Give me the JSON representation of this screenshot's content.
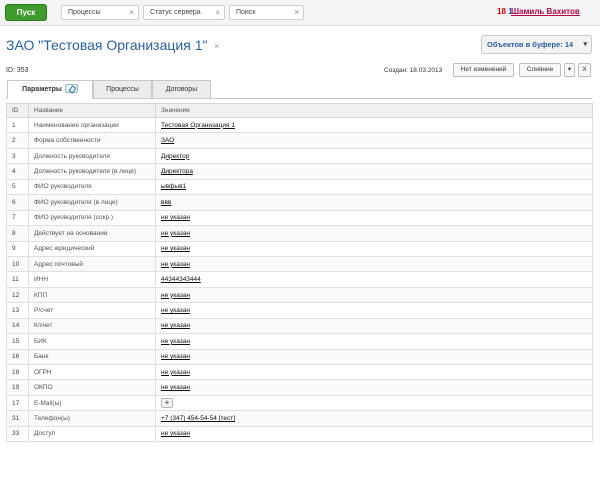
{
  "topbar": {
    "start_label": "Пуск",
    "tabs": [
      {
        "label": "Процессы"
      },
      {
        "label": "Статус сервера"
      },
      {
        "label": "Поиск"
      }
    ],
    "close_glyph": "×",
    "notif_count_red": "18",
    "notif_count_blue": "1",
    "user_name": "Шамиль Вахитов"
  },
  "header": {
    "title": "ЗАО \"Тестовая Организация 1\"",
    "close_glyph": "×",
    "buffer_label": "Объектов в буфере: 14",
    "buffer_caret": "▾"
  },
  "meta": {
    "id_text": "ID: 353",
    "created_text": "Создан: 18.03.2013",
    "no_changes_label": "Нет изменений",
    "merge_label": "Слияние",
    "dropdown_glyph": "▾",
    "close_label": "X"
  },
  "tabs": [
    {
      "label": "Параметры"
    },
    {
      "label": "Процессы"
    },
    {
      "label": "Договоры"
    }
  ],
  "table": {
    "headers": [
      "ID",
      "Название",
      "Значение"
    ],
    "rows": [
      {
        "id": "1",
        "name": "Наименование организации",
        "value": "Тестовая Организация 1"
      },
      {
        "id": "2",
        "name": "Форма собственности",
        "value": "ЗАО"
      },
      {
        "id": "3",
        "name": "Должность руководителя",
        "value": "Директор"
      },
      {
        "id": "4",
        "name": "Должность руководителя (в лице)",
        "value": "Директора"
      },
      {
        "id": "5",
        "name": "ФИО руководителя",
        "value": "ывфыв1"
      },
      {
        "id": "6",
        "name": "ФИО руководителя (в лице)",
        "value": "ввв"
      },
      {
        "id": "7",
        "name": "ФИО руководителя (сокр.)",
        "value": "не указан"
      },
      {
        "id": "8",
        "name": "Действует на основании",
        "value": "не указан"
      },
      {
        "id": "9",
        "name": "Адрес юридический",
        "value": "не указан"
      },
      {
        "id": "10",
        "name": "Адрес почтовый",
        "value": "не указан"
      },
      {
        "id": "11",
        "name": "ИНН",
        "value": "44344343444"
      },
      {
        "id": "12",
        "name": "КПП",
        "value": "не указан"
      },
      {
        "id": "13",
        "name": "Р/счет",
        "value": "не указан"
      },
      {
        "id": "14",
        "name": "К/счет",
        "value": "не указан"
      },
      {
        "id": "15",
        "name": "БИК",
        "value": "не указан"
      },
      {
        "id": "16",
        "name": "Банк",
        "value": "не указан"
      },
      {
        "id": "18",
        "name": "ОГРН",
        "value": "не указан"
      },
      {
        "id": "19",
        "name": "ОКПО",
        "value": "не указан"
      },
      {
        "id": "17",
        "name": "E-Mail(ы)",
        "value": "+"
      },
      {
        "id": "31",
        "name": "Телефон(ы)",
        "value": "+7 (347) 454-54-54 [тест]"
      },
      {
        "id": "33",
        "name": "Доступ",
        "value": "не указан"
      }
    ]
  }
}
